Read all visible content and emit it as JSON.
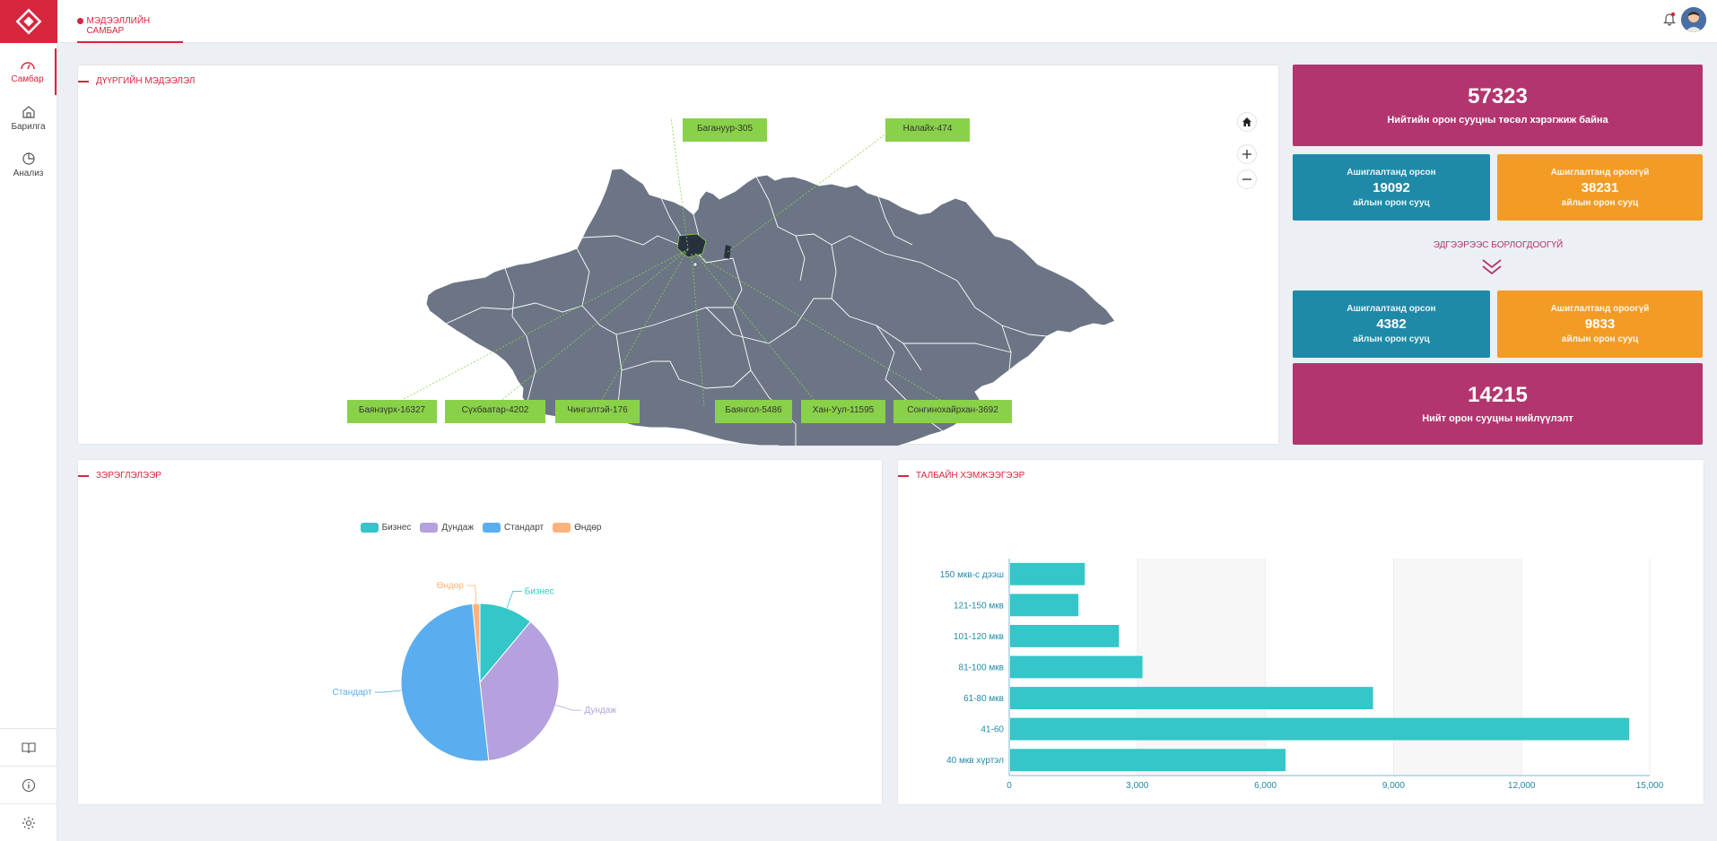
{
  "sidebar": {
    "items": [
      {
        "label": "Самбар",
        "icon": "gauge-icon",
        "active": true
      },
      {
        "label": "Барилга",
        "icon": "home-icon"
      },
      {
        "label": "Анализ",
        "icon": "pie-icon"
      }
    ],
    "bottom_icons": [
      "book-icon",
      "info-icon",
      "gear-icon"
    ]
  },
  "topbar": {
    "tab_label": "МЭДЭЭЛЛИЙН САМБАР"
  },
  "map_card": {
    "title": "ДҮҮРГИЙН МЭДЭЭЛЭЛ",
    "labels": [
      "Багануур-305",
      "Налайх-474",
      "Баянзүрх-16327",
      "Сүхбаатар-4202",
      "Чингэлтэй-176",
      "Баянгол-5486",
      "Хан-Уул-11595",
      "Сонгинохайрхан-3692"
    ]
  },
  "stats": {
    "total_top": {
      "value": "57323",
      "caption": "Нийтийн орон сууцны төсөл хэрэгжиж байна"
    },
    "commissioned_1": {
      "top": "Ашиглалтанд орсон",
      "value": "19092",
      "bottom": "айлын орон сууц"
    },
    "not_commissioned_1": {
      "top": "Ашиглалтанд ороогүй",
      "value": "38231",
      "bottom": "айлын орон сууц"
    },
    "mid_label": "ЭДГЭЭРЭЭС БОРЛОГДООГҮЙ",
    "commissioned_2": {
      "top": "Ашиглалтанд орсон",
      "value": "4382",
      "bottom": "айлын орон сууц"
    },
    "not_commissioned_2": {
      "top": "Ашиглалтанд ороогүй",
      "value": "9833",
      "bottom": "айлын орон сууц"
    },
    "total_bottom": {
      "value": "14215",
      "caption": "Нийт орон сууцны нийлүүлэлт"
    }
  },
  "pie_card": {
    "title": "ЗЭРЭГЛЭЛЭЭР"
  },
  "bar_card": {
    "title": "ТАЛБАЙН ХЭМЖЭЭГЭЭР"
  },
  "colors": {
    "accent": "#d7263d",
    "teal": "#34c6c8",
    "magenta": "#b3356f",
    "blue": "#1f8aa8",
    "orange": "#f39c25"
  },
  "chart_data": [
    {
      "type": "pie",
      "categories": [
        "Бизнес",
        "Дундаж",
        "Стандарт",
        "Өндөр"
      ],
      "values": [
        11,
        37,
        50,
        1.5
      ],
      "colors": [
        "#34c6c8",
        "#b4a1de",
        "#5aaeef",
        "#ffb27a"
      ],
      "legend": "top"
    },
    {
      "type": "bar",
      "orientation": "horizontal",
      "categories": [
        "150 мкв-с дээш",
        "121-150 мкв",
        "101-120 мкв",
        "81-100 мкв",
        "61-80 мкв",
        "41-60",
        "40 мкв хүртэл"
      ],
      "values": [
        1750,
        1600,
        2550,
        3100,
        8500,
        14500,
        6450
      ],
      "xlim": [
        0,
        15000
      ],
      "xticks": [
        "0",
        "3,000",
        "6,000",
        "9,000",
        "12,000",
        "15,000"
      ],
      "color": "#34c6c8"
    }
  ]
}
